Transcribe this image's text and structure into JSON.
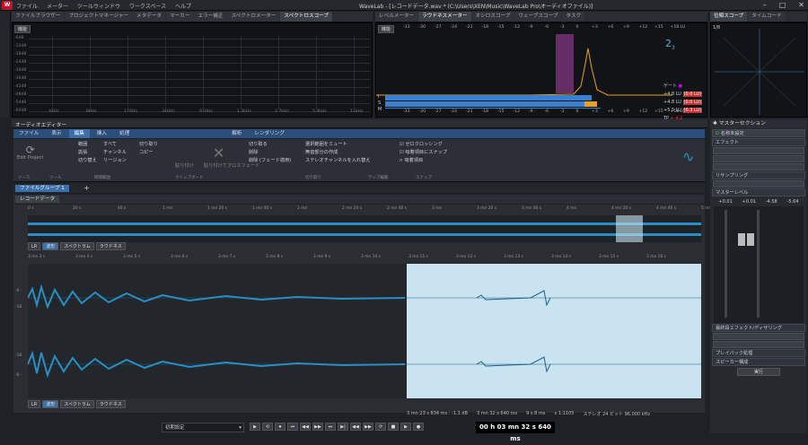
{
  "app": {
    "title": "WaveLab - [レコードデータ.wav * (C:\\Users\\XEN\\Music\\WaveLab Pro\\オーディオファイル)]",
    "menu": [
      "ファイル",
      "メーター",
      "ツールウィンドウ",
      "ワークスペース",
      "ヘルプ"
    ]
  },
  "top_tabs_left": [
    "ファイルブラウザー",
    "プロジェクトマネージャー",
    "メタデータ",
    "マーカー",
    "エラー補正",
    "スペクトロメーター",
    "スペクトロスコープ"
  ],
  "top_tabs_mid": [
    "レベルメーター",
    "ラウドネスメーター",
    "オシロスコープ",
    "ウェーブスコープ",
    "タスク"
  ],
  "top_tabs_right": [
    "位相スコープ",
    "タイムコード"
  ],
  "spectro": {
    "label": "機能",
    "db_labels": [
      "-6dB",
      "-12dB",
      "-18dB",
      "-24dB",
      "-30dB",
      "-36dB",
      "-42dB",
      "-48dB",
      "-54dB",
      "-60dB"
    ],
    "hz_labels": [
      "44Hz",
      "89Hz",
      "170Hz",
      "340Hz",
      "670Hz",
      "1.3kHz",
      "2.7kHz",
      "5.4kHz",
      "11kHz"
    ]
  },
  "loud": {
    "label": "機能",
    "scale": [
      "-33",
      "-30",
      "-27",
      "-24",
      "-21",
      "-18",
      "-15",
      "-12",
      "-9",
      "-6",
      "-3",
      "0",
      "+3",
      "+6",
      "+9",
      "+12",
      "+15",
      "+18 LU"
    ],
    "rows": [
      {
        "k": "I",
        "v": "+4.8 LU",
        "max": "(0.0 LU)"
      },
      {
        "k": "S",
        "v": "+4.8 LU",
        "max": "(0.0 LU)"
      },
      {
        "k": "M",
        "v": "+5.5 LU",
        "max": "(0.3 LU)"
      }
    ],
    "gate": "ゲート",
    "tp": "TP",
    "tp_v": "+ 4.2"
  },
  "phase": {
    "label": "1/8",
    "scale": "1"
  },
  "editor": {
    "title": "オーディオエディター",
    "rib_tabs": [
      "ファイル",
      "表示",
      "編集",
      "挿入",
      "処理",
      "解析",
      "レンダリング"
    ],
    "g1": [
      "範囲",
      "拡張",
      "切り替え"
    ],
    "g1b": [
      "すべて",
      "チャンネル",
      "リージョン"
    ],
    "g2": [
      "切り取り",
      "コピー",
      "貼り付け",
      "貼り付けてクロスフェード"
    ],
    "g3": [
      "切り取る",
      "削除",
      "削除 (フェード適用)"
    ],
    "g3b": [
      "選択範囲をミュート",
      "無音部分の作成",
      "ステレオチャンネルを入れ替え"
    ],
    "g4": [
      "ゼロクロッシング",
      "吸着項目にスナップ",
      "吸着項目"
    ],
    "sect": [
      "ソース",
      "ツール",
      "時間範囲",
      "クリップボード",
      "切り取り",
      "テップ編集",
      "スナップ"
    ],
    "edit_project": "Edit Project",
    "file_tab": "ファイルグループ 1",
    "doc_tab": "レコードデータ",
    "ruler": [
      "0 s",
      "20 s",
      "40 s",
      "1 mn",
      "1 mn 20 s",
      "1 mn 40 s",
      "2 mn",
      "2 mn 20 s",
      "2 mn 40 s",
      "3 mn",
      "3 mn 20 s",
      "3 mn 40 s",
      "4 mn",
      "4 mn 20 s",
      "4 mn 40 s",
      "5 mn"
    ],
    "ruler2": [
      "3 mn 3 s",
      "3 mn 4 s",
      "3 mn 5 s",
      "3 mn 6 s",
      "3 mn 7 s",
      "3 mn 8 s",
      "3 mn 9 s",
      "3 mn 10 s",
      "3 mn 11 s",
      "3 mn 12 s",
      "3 mn 13 s",
      "3 mn 14 s",
      "3 mn 15 s",
      "3 mn 16 s"
    ],
    "view_tabs": [
      "LR",
      "波形",
      "スペクトラム",
      "ラウドネス"
    ],
    "status": [
      "3 mn 23 s 834 ms : -1.1 dB",
      "3 mn 32 s 640 ms",
      "9 s 8 ms",
      "x 1:1105",
      "ステレオ 24 ビット 96.000 kHz"
    ],
    "db": [
      "-6 -",
      "-18",
      "-18",
      "-6 -"
    ]
  },
  "master": {
    "title": "マスターセクション",
    "preset": "名称未設定",
    "effects": "エフェクト",
    "resample": "リサンプリング",
    "level": "マスターレベル",
    "readouts": [
      "+0.01",
      "+0.01",
      "-4.58",
      "-5.64"
    ],
    "final": "最終段エフェクト/ディザリング",
    "playback": "プレイバック処理",
    "speaker": "スピーカー構成",
    "render": "実行"
  },
  "transport": {
    "preset": "初期設定",
    "time": "00 h 03 mn 32 s 640 ms"
  },
  "colors": {
    "wave": "#2a8ec4",
    "accent": "#3c6fa8",
    "loud_bar_blue": "#3a7fd0",
    "loud_bar_orange": "#e8a020",
    "loud_red": "#c83030",
    "selection": "#c9e4f0"
  }
}
